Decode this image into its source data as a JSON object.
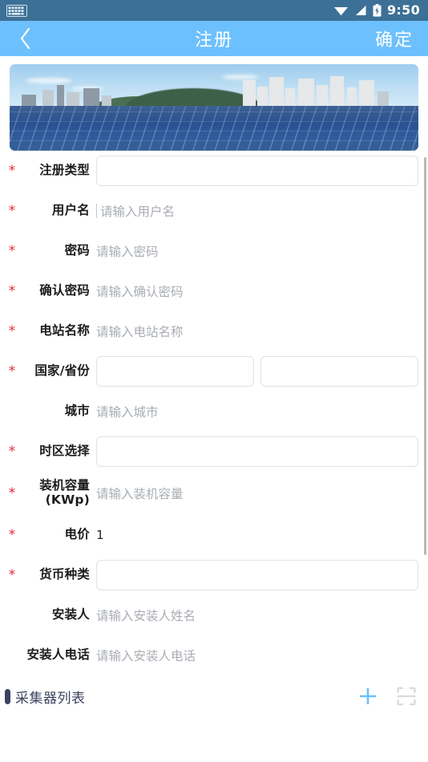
{
  "status_bar": {
    "keyboard_icon": "keyboard-icon",
    "wifi_icon": "wifi-icon",
    "signal_icon": "signal-icon",
    "battery_icon": "battery-icon",
    "time": "9:50",
    "background_color": "#3d7096"
  },
  "nav_bar": {
    "back_icon": "chevron-left-icon",
    "title": "注册",
    "action_label": "确定",
    "background_color": "#6cc0fd",
    "text_color": "#ffffff"
  },
  "banner": {
    "alt": "solar-panel-farm-photo"
  },
  "form": {
    "fields": [
      {
        "required": "*",
        "label": "注册类型",
        "label2": "",
        "type": "box",
        "value": "",
        "placeholder": ""
      },
      {
        "required": "*",
        "label": "用户名",
        "label2": "",
        "type": "text",
        "value": "",
        "placeholder": "请输入用户名",
        "focused": true
      },
      {
        "required": "*",
        "label": "密码",
        "label2": "",
        "type": "text",
        "value": "",
        "placeholder": "请输入密码"
      },
      {
        "required": "*",
        "label": "确认密码",
        "label2": "",
        "type": "text",
        "value": "",
        "placeholder": "请输入确认密码"
      },
      {
        "required": "*",
        "label": "电站名称",
        "label2": "",
        "type": "text",
        "value": "",
        "placeholder": "请输入电站名称"
      },
      {
        "required": "*",
        "label": "国家/省份",
        "label2": "",
        "type": "boxpair",
        "value": "",
        "placeholder": ""
      },
      {
        "required": "",
        "label": "城市",
        "label2": "",
        "type": "text",
        "value": "",
        "placeholder": "请输入城市"
      },
      {
        "required": "*",
        "label": "时区选择",
        "label2": "",
        "type": "box",
        "value": "",
        "placeholder": ""
      },
      {
        "required": "*",
        "label": "装机容量",
        "label2": "(KWp)",
        "type": "text",
        "value": "",
        "placeholder": "请输入装机容量"
      },
      {
        "required": "*",
        "label": "电价",
        "label2": "",
        "type": "value",
        "value": "1",
        "placeholder": ""
      },
      {
        "required": "*",
        "label": "货币种类",
        "label2": "",
        "type": "box",
        "value": "",
        "placeholder": ""
      },
      {
        "required": "",
        "label": "安装人",
        "label2": "",
        "type": "text",
        "value": "",
        "placeholder": "请输入安装人姓名"
      },
      {
        "required": "",
        "label": "安装人电话",
        "label2": "",
        "type": "text",
        "value": "",
        "placeholder": "请输入安装人电话"
      }
    ],
    "required_color": "#e8243c",
    "placeholder_color": "#a9adb3",
    "input_border_color": "#e2e2e2"
  },
  "collector_section": {
    "title": "采集器列表",
    "add_icon": "plus-icon",
    "scan_icon": "scan-icon",
    "add_icon_color": "#6cc0fd",
    "scan_icon_color": "#d8dade",
    "marker_color": "#3c4260"
  }
}
